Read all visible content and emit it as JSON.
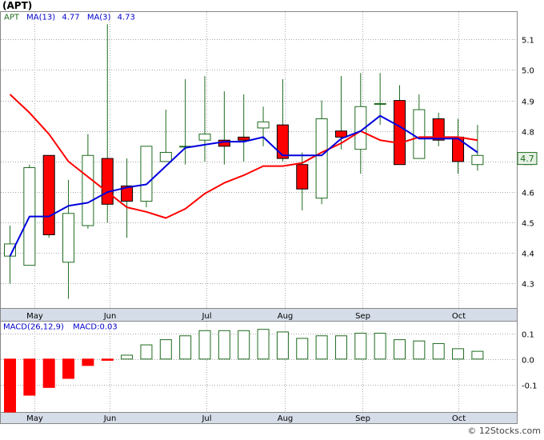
{
  "title": "(APT)",
  "watermark": "© 12Stocks.com",
  "colors": {
    "up_fill": "#ffffff",
    "up_stroke": "#1e6b1e",
    "down_fill": "#ff0000",
    "down_stroke": "#000000",
    "wick": "#1e6b1e",
    "ma13": "#ff0000",
    "ma3": "#0000dd",
    "legend_text": "#0000cc",
    "grid": "#a8a8a8",
    "axis_strip": "#d4dde8",
    "badge_fill": "#e6f2e6",
    "badge_text": "#1e6b1e"
  },
  "chart_data": [
    {
      "type": "candlestick",
      "legend": {
        "ticker_label": "APT",
        "ma13_label": "MA(13)",
        "ma13_value": "4.77",
        "ma3_label": "MA(3)",
        "ma3_value": "4.73"
      },
      "last_price_label": "4.7",
      "last_price": 4.71,
      "ylim": [
        4.22,
        5.19
      ],
      "yticks": [
        4.3,
        4.4,
        4.5,
        4.6,
        4.7,
        4.8,
        4.9,
        5.0,
        5.1
      ],
      "ytick_labels": [
        "4.3",
        "4.4",
        "4.5",
        "4.6",
        "4.7",
        "4.8",
        "4.9",
        "5.0",
        "5.1"
      ],
      "month_labels": [
        "May",
        "Jun",
        "Jul",
        "Aug",
        "Sep",
        "Oct"
      ],
      "month_positions": [
        1.25,
        5.1,
        10.1,
        14.1,
        18.1,
        23.0
      ],
      "grid": true,
      "ohlc": [
        {
          "o": 4.39,
          "h": 4.49,
          "l": 4.3,
          "c": 4.43
        },
        {
          "o": 4.36,
          "h": 4.69,
          "l": 4.36,
          "c": 4.68
        },
        {
          "o": 4.72,
          "h": 4.72,
          "l": 4.45,
          "c": 4.46
        },
        {
          "o": 4.37,
          "h": 4.64,
          "l": 4.25,
          "c": 4.53
        },
        {
          "o": 4.49,
          "h": 4.79,
          "l": 4.48,
          "c": 4.72
        },
        {
          "o": 4.71,
          "h": 5.15,
          "l": 4.5,
          "c": 4.56
        },
        {
          "o": 4.62,
          "h": 4.71,
          "l": 4.45,
          "c": 4.57
        },
        {
          "o": 4.57,
          "h": 4.75,
          "l": 4.55,
          "c": 4.75
        },
        {
          "o": 4.7,
          "h": 4.87,
          "l": 4.7,
          "c": 4.73
        },
        {
          "o": 4.75,
          "h": 4.97,
          "l": 4.69,
          "c": 4.75
        },
        {
          "o": 4.77,
          "h": 4.98,
          "l": 4.7,
          "c": 4.79
        },
        {
          "o": 4.77,
          "h": 4.93,
          "l": 4.69,
          "c": 4.75
        },
        {
          "o": 4.78,
          "h": 4.92,
          "l": 4.7,
          "c": 4.77
        },
        {
          "o": 4.81,
          "h": 4.88,
          "l": 4.75,
          "c": 4.83
        },
        {
          "o": 4.82,
          "h": 4.97,
          "l": 4.7,
          "c": 4.71
        },
        {
          "o": 4.69,
          "h": 4.73,
          "l": 4.54,
          "c": 4.61
        },
        {
          "o": 4.58,
          "h": 4.9,
          "l": 4.56,
          "c": 4.84
        },
        {
          "o": 4.8,
          "h": 4.98,
          "l": 4.74,
          "c": 4.78
        },
        {
          "o": 4.74,
          "h": 4.99,
          "l": 4.66,
          "c": 4.88
        },
        {
          "o": 4.89,
          "h": 4.99,
          "l": 4.82,
          "c": 4.89
        },
        {
          "o": 4.9,
          "h": 4.95,
          "l": 4.69,
          "c": 4.69
        },
        {
          "o": 4.71,
          "h": 4.92,
          "l": 4.71,
          "c": 4.87
        },
        {
          "o": 4.84,
          "h": 4.86,
          "l": 4.75,
          "c": 4.77
        },
        {
          "o": 4.78,
          "h": 4.84,
          "l": 4.66,
          "c": 4.7
        },
        {
          "o": 4.69,
          "h": 4.82,
          "l": 4.67,
          "c": 4.72
        }
      ],
      "series": [
        {
          "name": "MA(13)",
          "start": 0,
          "values": [
            4.92,
            4.86,
            4.79,
            4.7,
            4.65,
            4.6,
            4.55,
            4.535,
            4.515,
            4.545,
            4.595,
            4.63,
            4.655,
            4.685,
            4.685,
            4.695,
            4.73,
            4.76,
            4.8,
            4.77,
            4.76,
            4.78,
            4.78,
            4.78,
            4.77
          ]
        },
        {
          "name": "MA(3)",
          "start": 0,
          "values": [
            4.39,
            4.52,
            4.52,
            4.555,
            4.565,
            4.6,
            4.615,
            4.625,
            4.685,
            4.745,
            4.755,
            4.765,
            4.765,
            4.78,
            4.72,
            4.72,
            4.72,
            4.775,
            4.8,
            4.85,
            4.815,
            4.775,
            4.775,
            4.775,
            4.73
          ]
        }
      ]
    },
    {
      "type": "bar",
      "legend": {
        "label": "MACD(26,12,9)",
        "value_label": "MACD:",
        "value": "0.03"
      },
      "ylim": [
        -0.205,
        0.145
      ],
      "yticks": [
        0.1,
        0.0,
        -0.1
      ],
      "ytick_labels": [
        "0.1",
        "0.0",
        "-0.1"
      ],
      "month_labels": [
        "May",
        "Jun",
        "Jul",
        "Aug",
        "Sep",
        "Oct"
      ],
      "month_positions": [
        1.25,
        5.1,
        10.1,
        14.1,
        18.1,
        23.0
      ],
      "values": [
        -0.205,
        -0.14,
        -0.11,
        -0.075,
        -0.025,
        -0.005,
        0.015,
        0.055,
        0.075,
        0.09,
        0.11,
        0.11,
        0.11,
        0.115,
        0.105,
        0.08,
        0.09,
        0.09,
        0.1,
        0.1,
        0.075,
        0.07,
        0.06,
        0.04,
        0.03
      ]
    }
  ]
}
